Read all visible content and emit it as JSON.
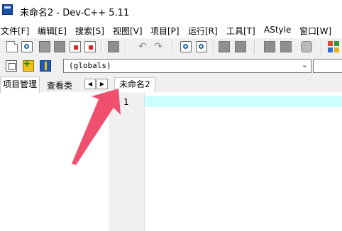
{
  "window": {
    "title": "未命名2 - Dev-C++ 5.11"
  },
  "menu": {
    "items": [
      {
        "label": "文件[F]"
      },
      {
        "label": "编辑[E]"
      },
      {
        "label": "搜索[S]"
      },
      {
        "label": "视图[V]"
      },
      {
        "label": "项目[P]"
      },
      {
        "label": "运行[R]"
      },
      {
        "label": "工具[T]"
      },
      {
        "label": "AStyle"
      },
      {
        "label": "窗口[W]"
      }
    ]
  },
  "toolbar": {
    "icons": [
      "new-file-icon",
      "open-icon",
      "save-icon",
      "save-all-icon",
      "close-file-icon",
      "close-all-icon",
      "print-icon",
      "undo-icon",
      "redo-icon",
      "find-icon",
      "replace-icon",
      "indent-icon",
      "unindent-icon",
      "toggle-bookmark-icon",
      "goto-bookmark-icon",
      "comment-icon",
      "compile-run-icon"
    ]
  },
  "toolbar2": {
    "icons": [
      "new-project-icon",
      "add-to-project-icon",
      "class-browser-icon"
    ],
    "scope_combo_value": "(globals)"
  },
  "left_panel": {
    "tabs": [
      {
        "label": "项目管理",
        "active": true
      },
      {
        "label": "查看类",
        "active": false
      }
    ],
    "scroll_left": "◀",
    "scroll_right": "▶"
  },
  "editor": {
    "tabs": [
      {
        "label": "未命名2",
        "active": true
      }
    ],
    "line_numbers": [
      "1"
    ],
    "current_line_color": "#ccffff"
  },
  "annotation": {
    "arrow_color": "#f0506e"
  }
}
